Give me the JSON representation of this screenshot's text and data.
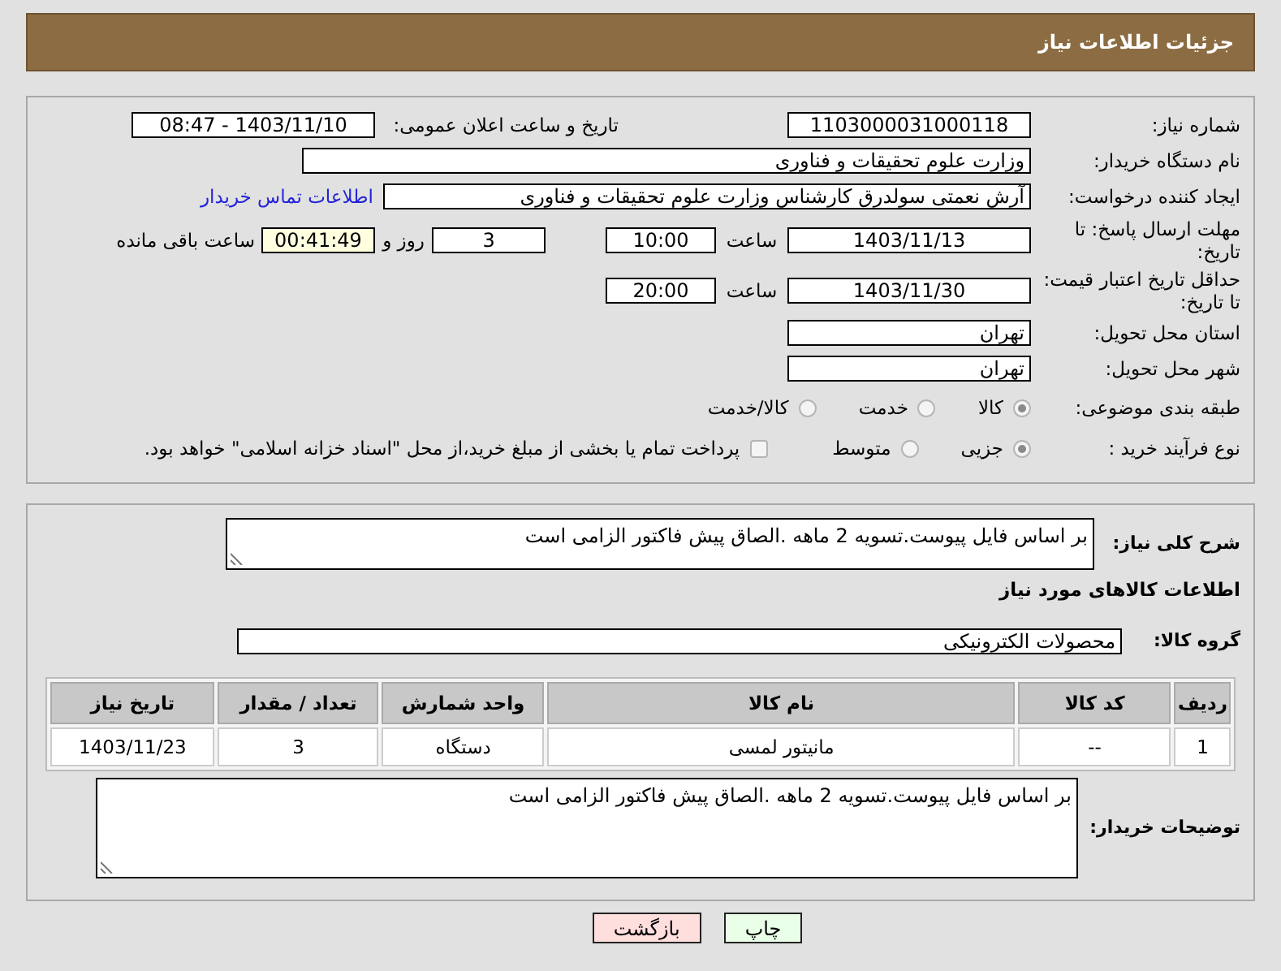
{
  "header": {
    "title": "جزئیات اطلاعات نیاز"
  },
  "need_number": {
    "label": "شماره نیاز:",
    "value": "1103000031000118"
  },
  "announce": {
    "label": "تاریخ و ساعت اعلان عمومی:",
    "value": "1403/11/10 - 08:47"
  },
  "buyer_org": {
    "label": "نام دستگاه خریدار:",
    "value": "وزارت علوم  تحقیقات و فناوری"
  },
  "creator": {
    "label": "ایجاد کننده درخواست:",
    "value": "آرش نعمتی سولدرق کارشناس وزارت علوم  تحقیقات و فناوری",
    "link": "اطلاعات تماس خریدار"
  },
  "reply_deadline": {
    "label": "مهلت ارسال پاسخ: تا تاریخ:",
    "date": "1403/11/13",
    "time_label": "ساعت",
    "time": "10:00",
    "days": "3",
    "days_label": "روز و",
    "remaining": "00:41:49",
    "remaining_label": "ساعت باقی مانده"
  },
  "price_validity": {
    "label": "حداقل تاریخ اعتبار قیمت: تا تاریخ:",
    "date": "1403/11/30",
    "time_label": "ساعت",
    "time": "20:00"
  },
  "province": {
    "label": "استان محل تحویل:",
    "value": "تهران"
  },
  "city": {
    "label": "شهر محل تحویل:",
    "value": "تهران"
  },
  "category": {
    "label": "طبقه بندی موضوعی:",
    "options": [
      {
        "label": "کالا",
        "selected": true
      },
      {
        "label": "خدمت",
        "selected": false
      },
      {
        "label": "کالا/خدمت",
        "selected": false
      }
    ]
  },
  "purchase_process": {
    "label": "نوع فرآیند خرید :",
    "options": [
      {
        "label": "جزیی",
        "selected": true
      },
      {
        "label": "متوسط",
        "selected": false
      }
    ],
    "payment": {
      "checked": false,
      "text": "پرداخت تمام یا بخشی از مبلغ خرید،از محل \"اسناد خزانه اسلامی\" خواهد بود."
    }
  },
  "description": {
    "label": "شرح کلی نیاز:",
    "value": "بر اساس فایل پیوست.تسویه 2 ماهه .الصاق پیش فاکتور الزامی است"
  },
  "goods_heading": "اطلاعات کالاهای مورد نیاز",
  "goods_group": {
    "label": "گروه کالا:",
    "value": "محصولات الکترونیکی"
  },
  "table": {
    "columns": [
      "ردیف",
      "کد کالا",
      "نام کالا",
      "واحد شمارش",
      "تعداد / مقدار",
      "تاریخ نیاز"
    ],
    "rows": [
      [
        "1",
        "--",
        "مانیتور لمسی",
        "دستگاه",
        "3",
        "1403/11/23"
      ]
    ]
  },
  "buyer_notes": {
    "label": "توضیحات خریدار:",
    "value": "بر اساس فایل پیوست.تسویه 2 ماهه .الصاق پیش فاکتور الزامی است"
  },
  "buttons": [
    {
      "label": "چاپ",
      "kind": "print"
    },
    {
      "label": "بازگشت",
      "kind": "back"
    }
  ]
}
